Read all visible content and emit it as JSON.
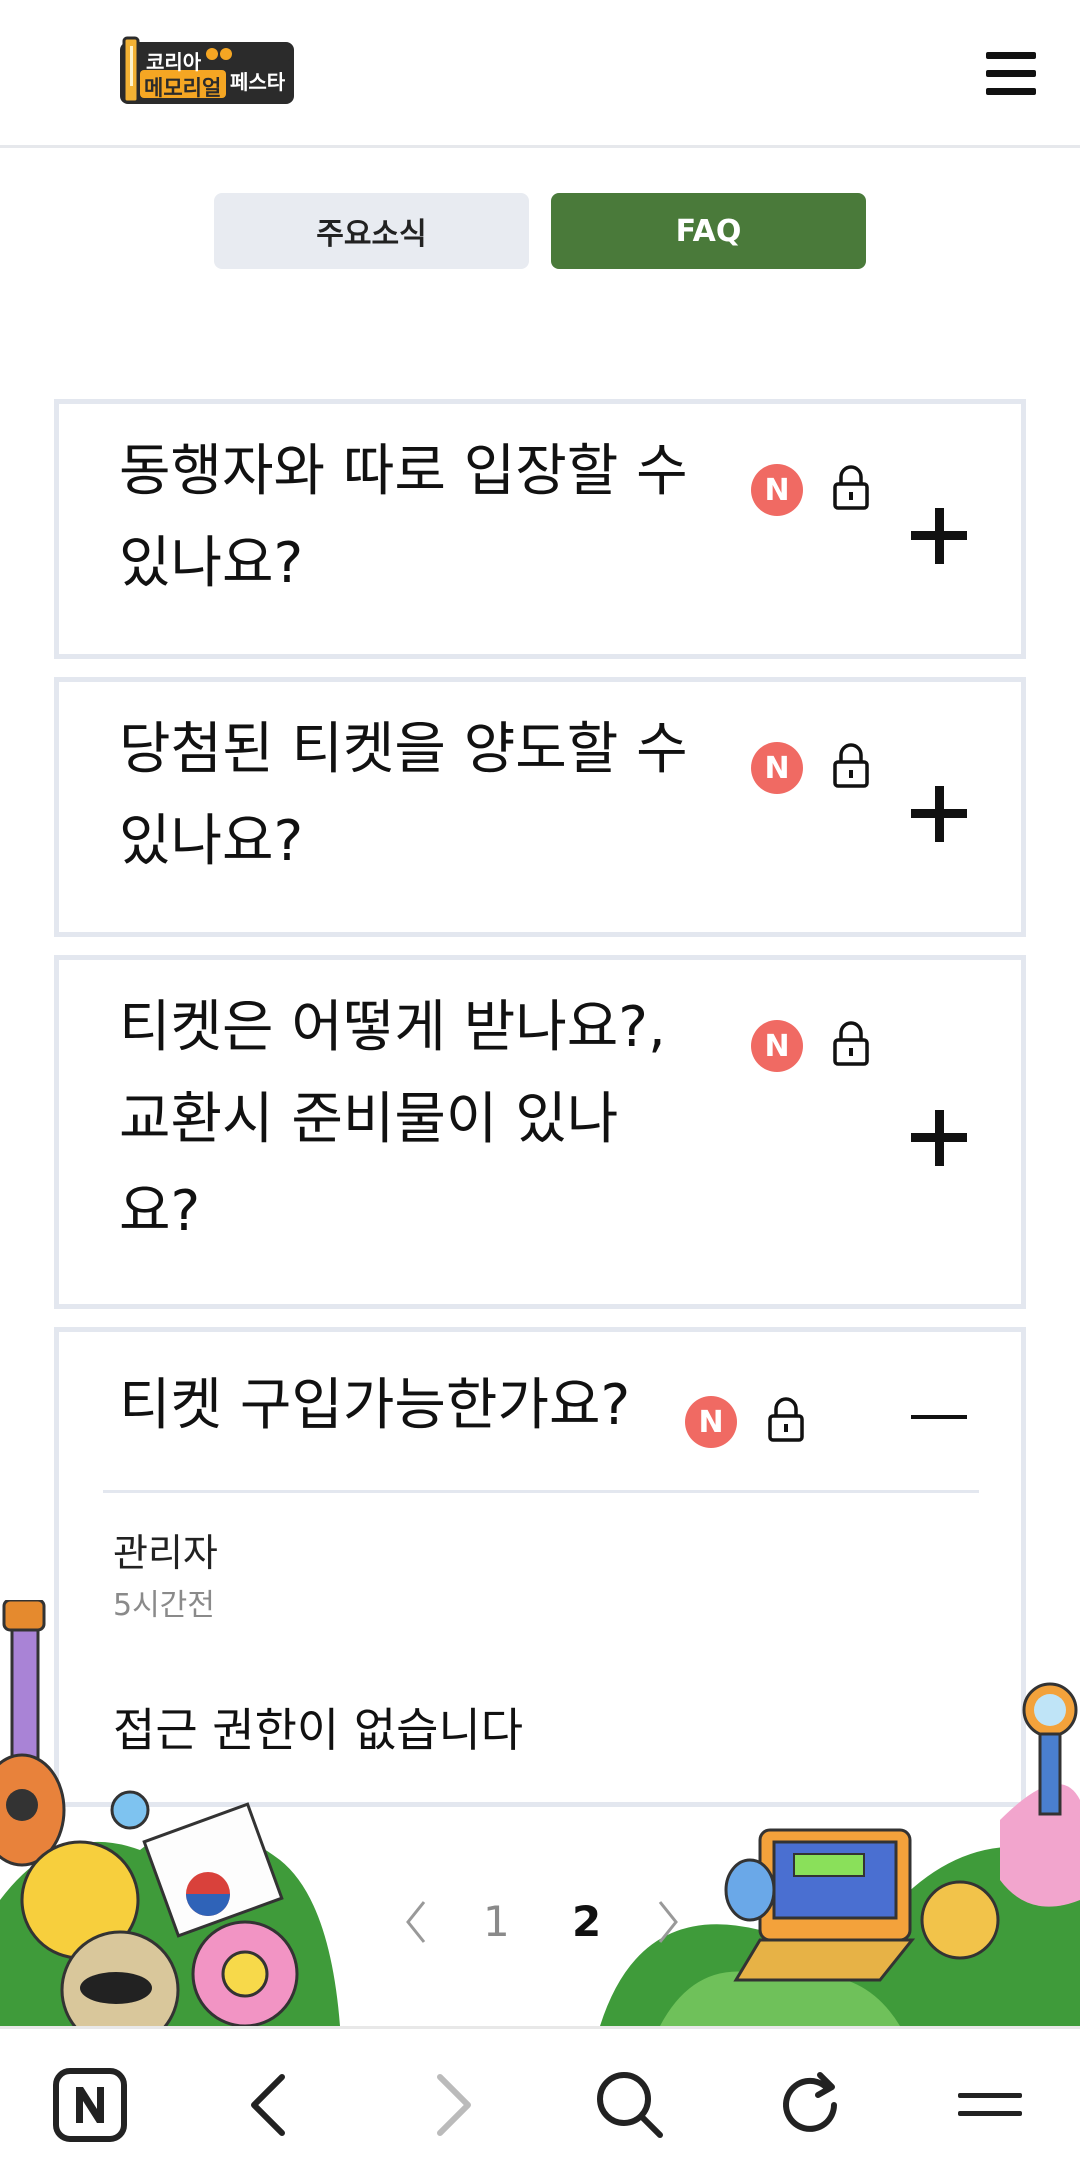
{
  "header": {
    "logo_top": "코리아",
    "logo_bottom": "메모리얼",
    "logo_side": "페스타",
    "menu_icon": "hamburger-menu-icon"
  },
  "tabs": [
    {
      "label": "주요소식",
      "active": false
    },
    {
      "label": "FAQ",
      "active": true
    }
  ],
  "faq": {
    "badge_label": "N",
    "items": [
      {
        "line1": "동행자와 따로 입장할 수",
        "line2": "있나요?",
        "line3": "",
        "expanded": false
      },
      {
        "line1": "당첨된 티켓을 양도할 수",
        "line2": "있나요?",
        "line3": "",
        "expanded": false
      },
      {
        "line1": "티켓은 어떻게 받나요?,",
        "line2": "교환시 준비물이 있나",
        "line3": "요?",
        "expanded": false
      },
      {
        "line1": "티켓 구입가능한가요?",
        "line2": "",
        "line3": "",
        "expanded": true,
        "author": "관리자",
        "time": "5시간전",
        "answer": "접근 권한이 없습니다"
      }
    ]
  },
  "pagination": {
    "pages": [
      "1",
      "2"
    ],
    "current": "2"
  },
  "colors": {
    "accent_green": "#4a7a3a",
    "badge_red": "#f06a63",
    "border": "#e3e7ef"
  },
  "bottom_bar": {
    "icons": [
      "naver-home-icon",
      "back-icon",
      "forward-icon",
      "search-icon",
      "refresh-icon",
      "menu-icon"
    ]
  }
}
